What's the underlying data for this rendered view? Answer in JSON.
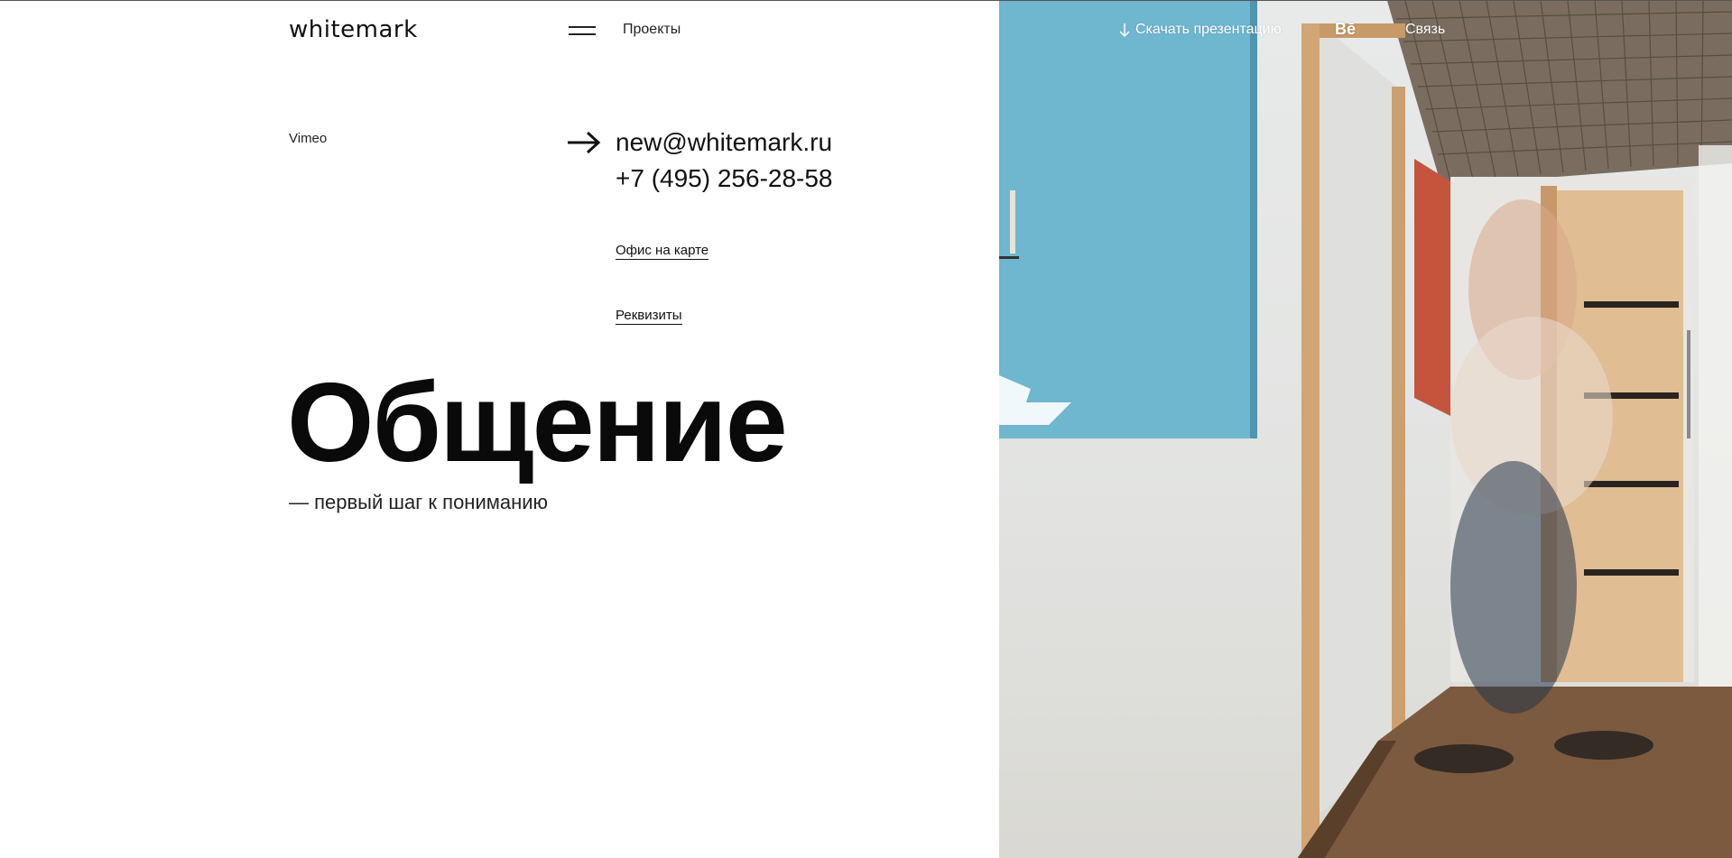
{
  "header": {
    "logo": "whitemark",
    "nav_projects": "Проекты",
    "download_label": "Скачать презентацию",
    "behance_label": "Bē",
    "contact_label": "Связь"
  },
  "sidebar": {
    "vimeo_label": "Vimeo"
  },
  "contacts": {
    "email": "new@whitemark.ru",
    "phone": "+7 (495) 256-28-58",
    "map_link": "Офис на карте",
    "requisites_link": "Реквизиты"
  },
  "hero": {
    "title": "Общение",
    "subtitle": "— первый шаг к пониманию"
  },
  "icons": {
    "menu": "hamburger-icon",
    "download": "arrow-down-icon",
    "arrow": "arrow-right-icon"
  },
  "colors": {
    "background": "#ffffff",
    "text": "#111111",
    "header_on_photo": "#ffffff"
  }
}
